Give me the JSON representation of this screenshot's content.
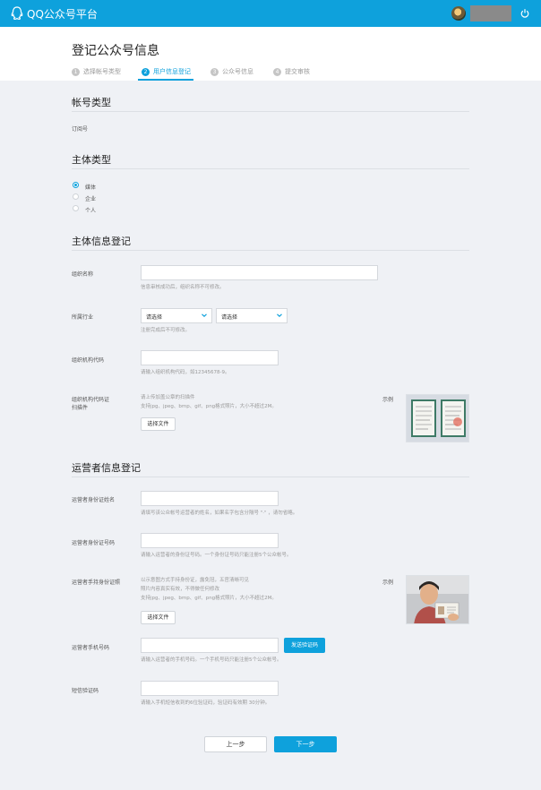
{
  "app": {
    "brand": "QQ公众号平台"
  },
  "header": {
    "title": "登记公众号信息"
  },
  "steps": [
    {
      "num": "1",
      "label": "选择帐号类型"
    },
    {
      "num": "2",
      "label": "用户信息登记"
    },
    {
      "num": "3",
      "label": "公众号信息"
    },
    {
      "num": "4",
      "label": "提交审核"
    }
  ],
  "account_type": {
    "title": "帐号类型",
    "value": "订阅号"
  },
  "subject_type": {
    "title": "主体类型",
    "options": [
      "媒体",
      "企业",
      "个人"
    ],
    "selected": "媒体"
  },
  "subject_info": {
    "title": "主体信息登记",
    "org_name": {
      "label": "组织名称",
      "help": "信息审核成功后，组织名称不可修改。"
    },
    "industry": {
      "label": "所属行业",
      "select1": "请选择",
      "select2": "请选择",
      "help": "注册完成后不可修改。"
    },
    "org_code": {
      "label": "组织机构代码",
      "help": "请输入组织机构代码，如12345678-9。"
    },
    "org_scan": {
      "label_line1": "组织机构代码证",
      "label_line2": "扫描件",
      "help_line1": "请上传加盖公章的扫描件",
      "help_line2": "支持jpg、jpeg、bmp、gif、png格式照片，大小不超过2M。",
      "button": "选择文件",
      "sample_label": "示例"
    }
  },
  "operator_info": {
    "title": "运营者信息登记",
    "name": {
      "label": "运营者身份证姓名",
      "help": "请填写该公众帐号运营者的姓名，如果名字包含分隔号 \"·\" ，请勿省略。"
    },
    "id_number": {
      "label": "运营者身份证号码",
      "help": "请输入运营者的身份证号码。一个身份证号码只能注册5个公众帐号。"
    },
    "id_photo": {
      "label": "运营者手持身份证照",
      "help_line1": "以示意图方式手持身份证，露免冠，五官清晰可见",
      "help_line2": "照片内容真实有效，不得做任何修改",
      "help_line3": "支持jpg、jpeg、bmp、gif、png格式照片，大小不超过2M。",
      "button": "选择文件",
      "sample_label": "示例"
    },
    "phone": {
      "label": "运营者手机号码",
      "button": "发送验证码",
      "help": "请输入运营者的手机号码。一个手机号码只能注册5个公众帐号。"
    },
    "sms": {
      "label": "短信验证码",
      "help": "请输入手机短信收到的6位验证码，验证码有效期 30分钟。"
    }
  },
  "footer": {
    "prev": "上一步",
    "next": "下一步"
  },
  "colors": {
    "accent": "#0ea1dc",
    "background": "#eff1f5"
  }
}
